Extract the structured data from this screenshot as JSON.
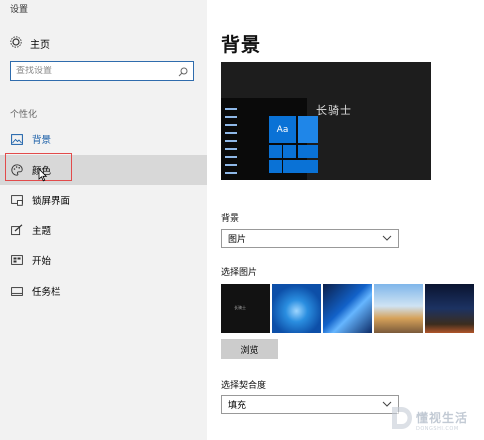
{
  "window": {
    "title": "设置"
  },
  "sidebar": {
    "home_label": "主页",
    "search_placeholder": "查找设置",
    "section_label": "个性化",
    "items": [
      {
        "label": "背景",
        "icon": "image-icon",
        "active": true
      },
      {
        "label": "颜色",
        "icon": "palette-icon",
        "selected": true
      },
      {
        "label": "锁屏界面",
        "icon": "lock-screen-icon"
      },
      {
        "label": "主题",
        "icon": "theme-icon"
      },
      {
        "label": "开始",
        "icon": "start-icon"
      },
      {
        "label": "任务栏",
        "icon": "taskbar-icon"
      }
    ]
  },
  "main": {
    "title": "背景",
    "preview": {
      "tile_text": "Aa",
      "wallpaper_text": "长骑士"
    },
    "background_label": "背景",
    "background_value": "图片",
    "choose_picture_label": "选择图片",
    "thumb1_text": "长骑士",
    "browse_label": "浏览",
    "fit_label": "选择契合度",
    "fit_value": "填充"
  },
  "watermark": {
    "name": "懂视生活",
    "sub": "DONGSHI.COM"
  },
  "colors": {
    "accent": "#0a72d6",
    "selection_box": "#e24b4b",
    "sidebar_bg": "#f2f2f2"
  }
}
